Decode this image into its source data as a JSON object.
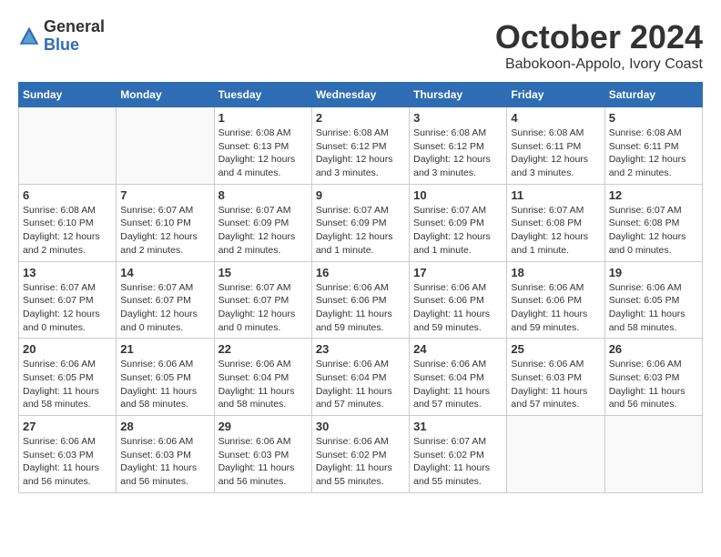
{
  "logo": {
    "general": "General",
    "blue": "Blue"
  },
  "header": {
    "month": "October 2024",
    "location": "Babokoon-Appolo, Ivory Coast"
  },
  "weekdays": [
    "Sunday",
    "Monday",
    "Tuesday",
    "Wednesday",
    "Thursday",
    "Friday",
    "Saturday"
  ],
  "weeks": [
    [
      {
        "day": "",
        "info": ""
      },
      {
        "day": "",
        "info": ""
      },
      {
        "day": "1",
        "info": "Sunrise: 6:08 AM\nSunset: 6:13 PM\nDaylight: 12 hours\nand 4 minutes."
      },
      {
        "day": "2",
        "info": "Sunrise: 6:08 AM\nSunset: 6:12 PM\nDaylight: 12 hours\nand 3 minutes."
      },
      {
        "day": "3",
        "info": "Sunrise: 6:08 AM\nSunset: 6:12 PM\nDaylight: 12 hours\nand 3 minutes."
      },
      {
        "day": "4",
        "info": "Sunrise: 6:08 AM\nSunset: 6:11 PM\nDaylight: 12 hours\nand 3 minutes."
      },
      {
        "day": "5",
        "info": "Sunrise: 6:08 AM\nSunset: 6:11 PM\nDaylight: 12 hours\nand 2 minutes."
      }
    ],
    [
      {
        "day": "6",
        "info": "Sunrise: 6:08 AM\nSunset: 6:10 PM\nDaylight: 12 hours\nand 2 minutes."
      },
      {
        "day": "7",
        "info": "Sunrise: 6:07 AM\nSunset: 6:10 PM\nDaylight: 12 hours\nand 2 minutes."
      },
      {
        "day": "8",
        "info": "Sunrise: 6:07 AM\nSunset: 6:09 PM\nDaylight: 12 hours\nand 2 minutes."
      },
      {
        "day": "9",
        "info": "Sunrise: 6:07 AM\nSunset: 6:09 PM\nDaylight: 12 hours\nand 1 minute."
      },
      {
        "day": "10",
        "info": "Sunrise: 6:07 AM\nSunset: 6:09 PM\nDaylight: 12 hours\nand 1 minute."
      },
      {
        "day": "11",
        "info": "Sunrise: 6:07 AM\nSunset: 6:08 PM\nDaylight: 12 hours\nand 1 minute."
      },
      {
        "day": "12",
        "info": "Sunrise: 6:07 AM\nSunset: 6:08 PM\nDaylight: 12 hours\nand 0 minutes."
      }
    ],
    [
      {
        "day": "13",
        "info": "Sunrise: 6:07 AM\nSunset: 6:07 PM\nDaylight: 12 hours\nand 0 minutes."
      },
      {
        "day": "14",
        "info": "Sunrise: 6:07 AM\nSunset: 6:07 PM\nDaylight: 12 hours\nand 0 minutes."
      },
      {
        "day": "15",
        "info": "Sunrise: 6:07 AM\nSunset: 6:07 PM\nDaylight: 12 hours\nand 0 minutes."
      },
      {
        "day": "16",
        "info": "Sunrise: 6:06 AM\nSunset: 6:06 PM\nDaylight: 11 hours\nand 59 minutes."
      },
      {
        "day": "17",
        "info": "Sunrise: 6:06 AM\nSunset: 6:06 PM\nDaylight: 11 hours\nand 59 minutes."
      },
      {
        "day": "18",
        "info": "Sunrise: 6:06 AM\nSunset: 6:06 PM\nDaylight: 11 hours\nand 59 minutes."
      },
      {
        "day": "19",
        "info": "Sunrise: 6:06 AM\nSunset: 6:05 PM\nDaylight: 11 hours\nand 58 minutes."
      }
    ],
    [
      {
        "day": "20",
        "info": "Sunrise: 6:06 AM\nSunset: 6:05 PM\nDaylight: 11 hours\nand 58 minutes."
      },
      {
        "day": "21",
        "info": "Sunrise: 6:06 AM\nSunset: 6:05 PM\nDaylight: 11 hours\nand 58 minutes."
      },
      {
        "day": "22",
        "info": "Sunrise: 6:06 AM\nSunset: 6:04 PM\nDaylight: 11 hours\nand 58 minutes."
      },
      {
        "day": "23",
        "info": "Sunrise: 6:06 AM\nSunset: 6:04 PM\nDaylight: 11 hours\nand 57 minutes."
      },
      {
        "day": "24",
        "info": "Sunrise: 6:06 AM\nSunset: 6:04 PM\nDaylight: 11 hours\nand 57 minutes."
      },
      {
        "day": "25",
        "info": "Sunrise: 6:06 AM\nSunset: 6:03 PM\nDaylight: 11 hours\nand 57 minutes."
      },
      {
        "day": "26",
        "info": "Sunrise: 6:06 AM\nSunset: 6:03 PM\nDaylight: 11 hours\nand 56 minutes."
      }
    ],
    [
      {
        "day": "27",
        "info": "Sunrise: 6:06 AM\nSunset: 6:03 PM\nDaylight: 11 hours\nand 56 minutes."
      },
      {
        "day": "28",
        "info": "Sunrise: 6:06 AM\nSunset: 6:03 PM\nDaylight: 11 hours\nand 56 minutes."
      },
      {
        "day": "29",
        "info": "Sunrise: 6:06 AM\nSunset: 6:03 PM\nDaylight: 11 hours\nand 56 minutes."
      },
      {
        "day": "30",
        "info": "Sunrise: 6:06 AM\nSunset: 6:02 PM\nDaylight: 11 hours\nand 55 minutes."
      },
      {
        "day": "31",
        "info": "Sunrise: 6:07 AM\nSunset: 6:02 PM\nDaylight: 11 hours\nand 55 minutes."
      },
      {
        "day": "",
        "info": ""
      },
      {
        "day": "",
        "info": ""
      }
    ]
  ]
}
